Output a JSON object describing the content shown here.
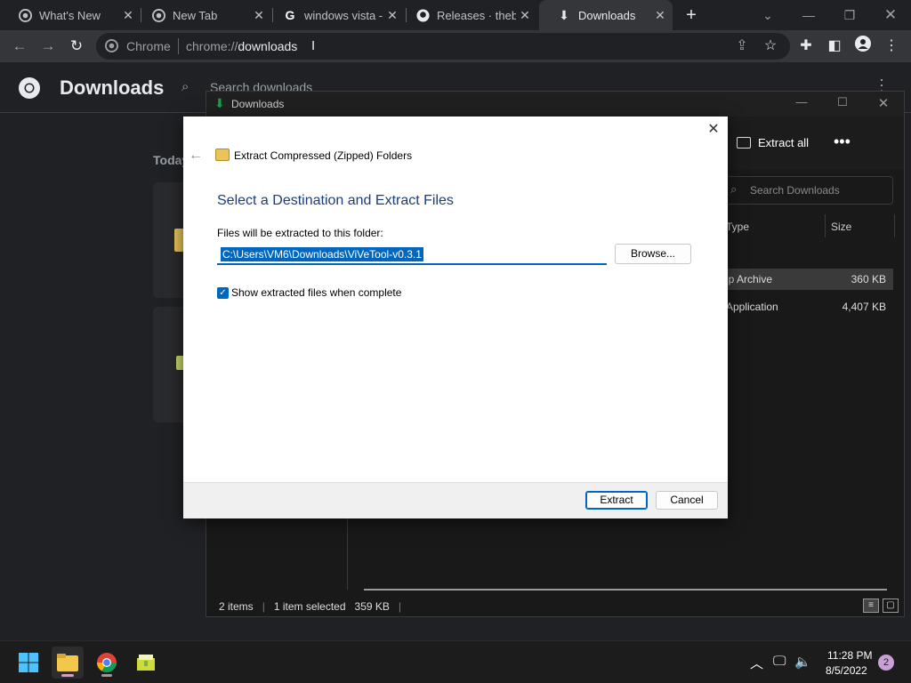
{
  "chrome": {
    "tabs": [
      {
        "title": "What's New",
        "icon": "chrome-icon",
        "active": false
      },
      {
        "title": "New Tab",
        "icon": "chrome-icon",
        "active": false
      },
      {
        "title": "windows vista -",
        "icon": "google-icon",
        "active": false
      },
      {
        "title": "Releases · thebo",
        "icon": "github-icon",
        "active": false
      },
      {
        "title": "Downloads",
        "icon": "download-icon",
        "active": true
      }
    ],
    "omnibox": {
      "site_label": "Chrome",
      "url_prefix": "chrome://",
      "url_host": "downloads"
    }
  },
  "downloads_page": {
    "title": "Downloads",
    "search_placeholder": "Search downloads",
    "group_label": "Today"
  },
  "explorer": {
    "title": "Downloads",
    "extract_all_label": "Extract all",
    "search_placeholder": "Search Downloads",
    "columns": {
      "type": "Type",
      "size": "Size"
    },
    "rows": [
      {
        "type": "ip Archive",
        "size": "360 KB",
        "selected": true
      },
      {
        "type": "Application",
        "size": "4,407 KB",
        "selected": false
      }
    ],
    "status": {
      "items": "2 items",
      "selected": "1 item selected",
      "selected_size": "359 KB"
    }
  },
  "dialog": {
    "wizard_title": "Extract Compressed (Zipped) Folders",
    "heading": "Select a Destination and Extract Files",
    "folder_label": "Files will be extracted to this folder:",
    "path": "C:\\Users\\VM6\\Downloads\\ViVeTool-v0.3.1",
    "browse_label": "Browse...",
    "checkbox_label": "Show extracted files when complete",
    "checkbox_checked": true,
    "extract_label": "Extract",
    "cancel_label": "Cancel"
  },
  "taskbar": {
    "time": "11:28 PM",
    "date": "8/5/2022",
    "notification_count": "2"
  },
  "colors": {
    "accent": "#0067c0",
    "heading": "#1c3d78"
  }
}
